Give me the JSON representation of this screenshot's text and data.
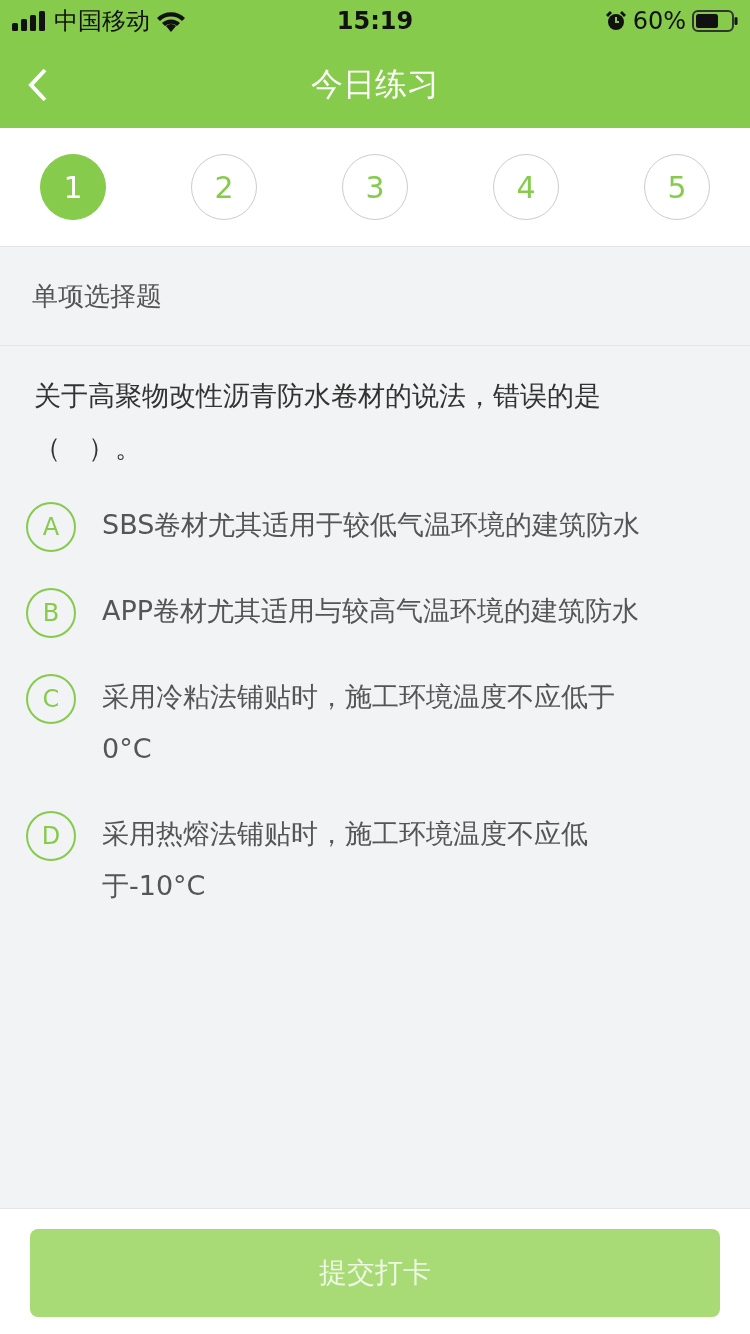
{
  "status_bar": {
    "carrier": "中国移动",
    "time": "15:19",
    "battery": "60%"
  },
  "nav": {
    "title": "今日练习"
  },
  "steps": [
    {
      "label": "1",
      "selected": true
    },
    {
      "label": "2",
      "selected": false
    },
    {
      "label": "3",
      "selected": false
    },
    {
      "label": "4",
      "selected": false
    },
    {
      "label": "5",
      "selected": false
    }
  ],
  "question_type": "单项选择题",
  "question": "关于高聚物改性沥青防水卷材的说法，错误的是（　）。",
  "options": [
    {
      "letter": "A",
      "text": "SBS卷材尤其适用于较低气温环境的建筑防水",
      "selected": false
    },
    {
      "letter": "B",
      "text": "APP卷材尤其适用与较高气温环境的建筑防水",
      "selected": false
    },
    {
      "letter": "C",
      "text": "采用冷粘法铺贴时，施工环境温度不应低于0°C",
      "selected": false
    },
    {
      "letter": "D",
      "text": "采用热熔法铺贴时，施工环境温度不应低于-10°C",
      "selected": false
    }
  ],
  "submit": {
    "label": "提交打卡",
    "disabled": true
  }
}
